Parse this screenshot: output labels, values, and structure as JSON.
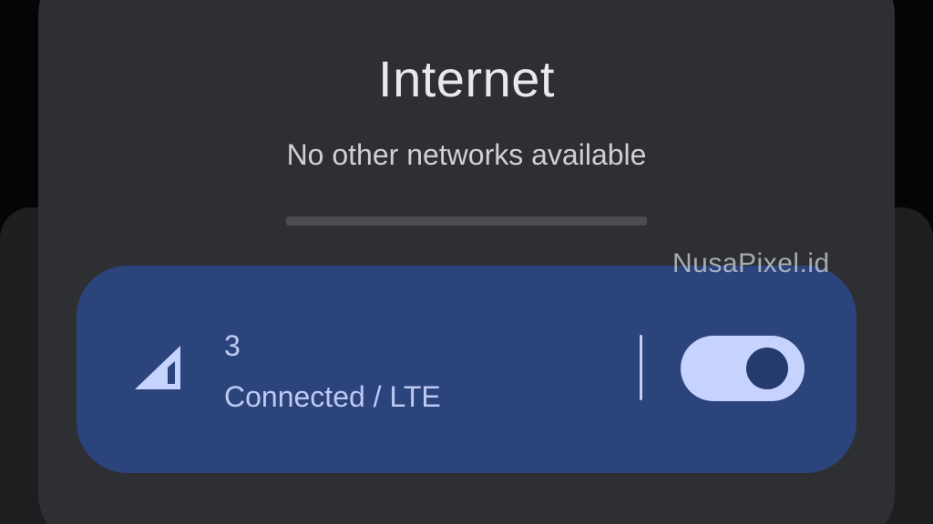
{
  "dialog": {
    "title": "Internet",
    "subtitle": "No other networks available"
  },
  "network": {
    "carrier": "3",
    "status": "Connected / LTE",
    "signal_icon": "cellular-signal-icon",
    "toggle_on": true
  },
  "watermark": {
    "text": "NusaPixel.id"
  },
  "colors": {
    "panel": "#2e2f33",
    "card": "#2c447c",
    "card_text": "#bdc9f2",
    "toggle_track": "#c7d3ff",
    "toggle_knob": "#253b6e"
  }
}
